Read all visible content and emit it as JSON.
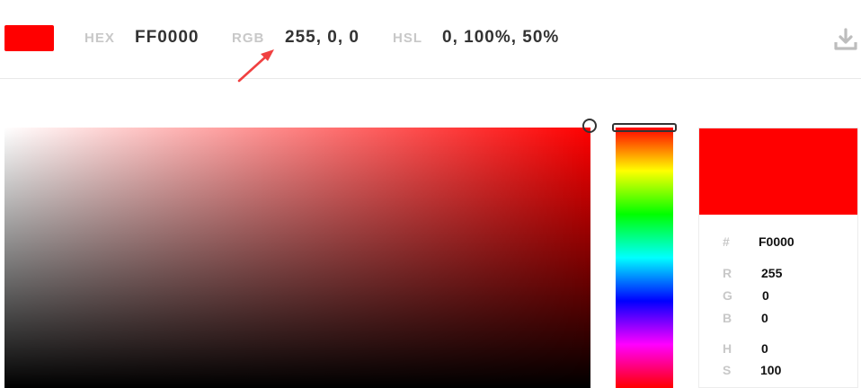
{
  "colors": {
    "current": "#ff0000",
    "hue": "#ff0000",
    "annotation": "#f04040"
  },
  "topbar": {
    "hex_label": "HEX",
    "hex_value": "FF0000",
    "rgb_label": "RGB",
    "rgb_value": "255, 0, 0",
    "hsl_label": "HSL",
    "hsl_value": "0, 100%, 50%",
    "download_icon": "download-icon"
  },
  "panel": {
    "hex_label": "#",
    "hex_value": "F0000",
    "r_label": "R",
    "r_value": "255",
    "g_label": "G",
    "g_value": "0",
    "b_label": "B",
    "b_value": "0",
    "h_label": "H",
    "h_value": "0",
    "s_label": "S",
    "s_value": "100"
  }
}
